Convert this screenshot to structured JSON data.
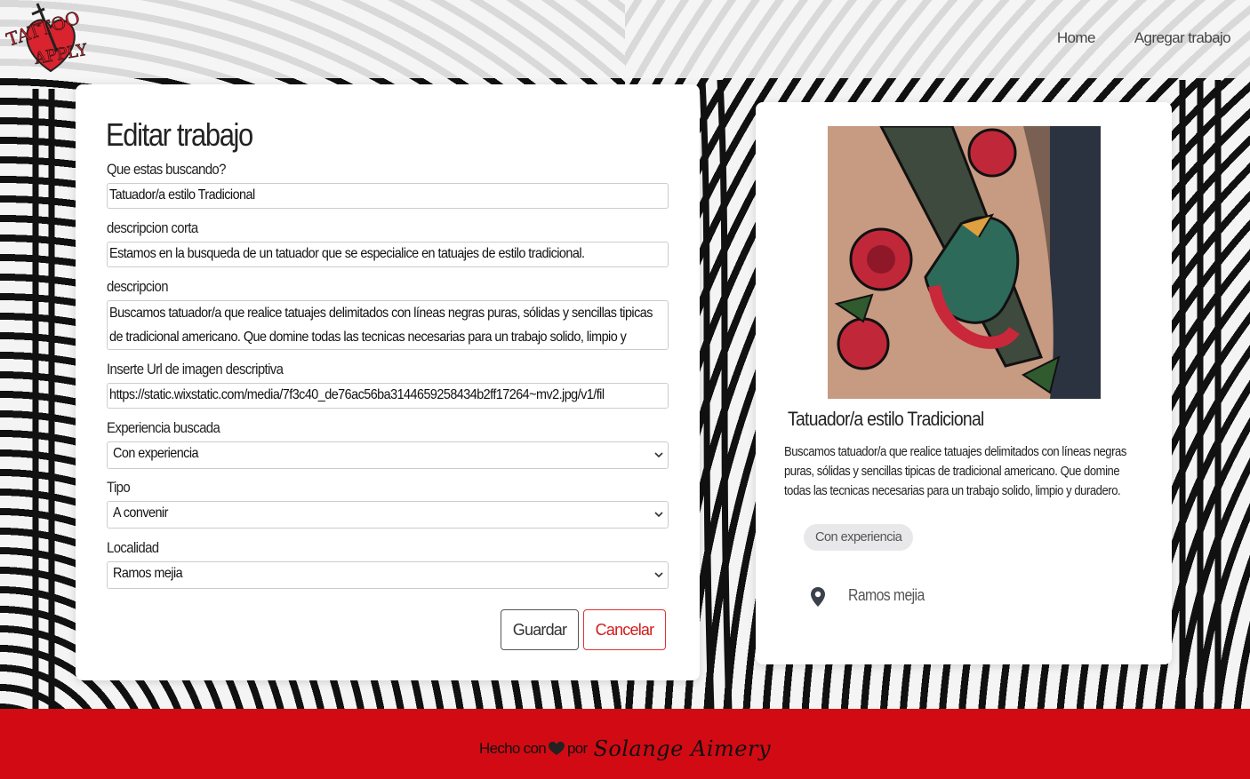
{
  "nav": {
    "logo_text_top": "TATTOO",
    "logo_text_bottom": "APPLY",
    "links": [
      "Home",
      "Agregar trabajo"
    ]
  },
  "form": {
    "title": "Editar trabajo",
    "fields": [
      {
        "label": "Que estas buscando?",
        "value": "Tatuador/a estilo Tradicional"
      },
      {
        "label": "descripcion corta",
        "value": "Estamos en la busqueda de un tatuador que se especialice en tatuajes de estilo tradicional."
      },
      {
        "label": "descripcion",
        "value": "Buscamos tatuador/a que realice tatuajes delimitados con líneas negras puras, sólidas y sencillas tipicas de tradicional americano. Que domine todas las tecnicas necesarias para un trabajo solido, limpio y duradero."
      },
      {
        "label": "Inserte Url de imagen descriptiva",
        "value": "https://static.wixstatic.com/media/7f3c40_de76ac56ba3144659258434b2ff17264~mv2.jpg/v1/fil"
      },
      {
        "label": "Experiencia buscada",
        "value": "Con experiencia"
      },
      {
        "label": "Tipo",
        "value": "A convenir"
      },
      {
        "label": "Localidad",
        "value": "Ramos mejia"
      }
    ],
    "save_label": "Guardar",
    "cancel_label": "Cancelar"
  },
  "preview": {
    "title": "Tatuador/a estilo Tradicional",
    "description": "Buscamos tatuador/a que realice tatuajes delimitados con líneas negras puras, sólidas y sencillas tipicas de tradicional americano. Que domine todas las tecnicas necesarias para un trabajo solido, limpio y duradero.",
    "badge": "Con experiencia",
    "location": "Ramos mejia"
  },
  "footer": {
    "text_before": "Hecho con",
    "text_after": "por",
    "signature": "Solange Aimery"
  },
  "colors": {
    "brand_red": "#d20a13",
    "cancel_red": "#d01c1c"
  }
}
